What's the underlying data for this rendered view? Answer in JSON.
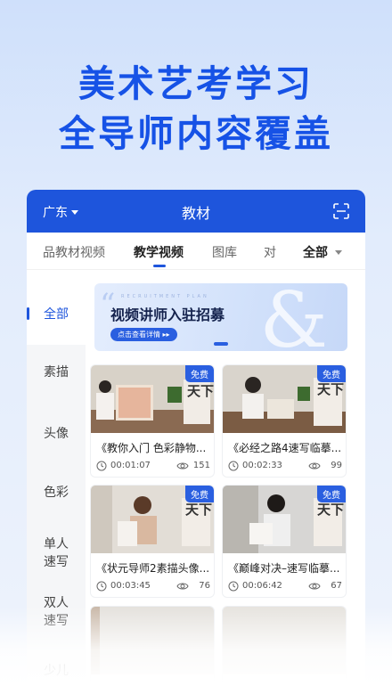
{
  "hero": {
    "line1": "美术艺考学习",
    "line2": "全导师内容覆盖"
  },
  "topbar": {
    "region": "广东",
    "title": "教材"
  },
  "tabs": {
    "items": [
      "品教材视频",
      "教学视频",
      "图库",
      "对"
    ],
    "all": "全部"
  },
  "sidebar": {
    "items": [
      "全部",
      "素描",
      "头像",
      "色彩",
      "单人\n速写",
      "双人\n速写",
      "少儿"
    ]
  },
  "banner": {
    "sub": "RECRUITMENT PLAN",
    "headline": "视频讲师入驻招募",
    "cta": "点击查看详情 ▸▸",
    "amp": "&"
  },
  "badge": "免费",
  "cards": [
    {
      "title": "《教你入门 色彩静物...",
      "duration": "00:01:07",
      "views": "151"
    },
    {
      "title": "《必经之路4速写临摹...",
      "duration": "00:02:33",
      "views": "99"
    },
    {
      "title": "《状元导师2素描头像...",
      "duration": "00:03:45",
      "views": "76"
    },
    {
      "title": "《巅峰对决–速写临摹...",
      "duration": "00:06:42",
      "views": "67"
    }
  ],
  "colors": {
    "brand": "#1e55dc",
    "hero_text": "#1652e6"
  }
}
